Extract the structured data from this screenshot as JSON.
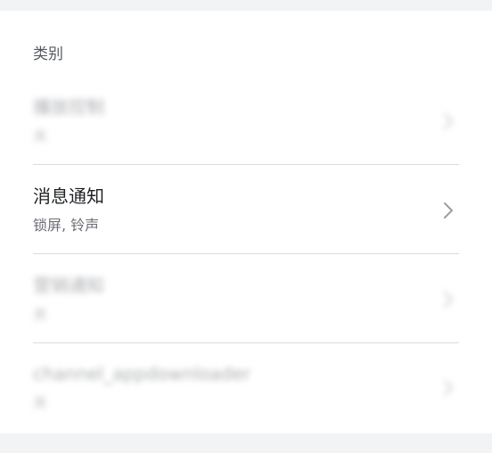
{
  "section": {
    "title": "类别"
  },
  "rows": [
    {
      "title": "播放控制",
      "subtitle": "关",
      "blurred": true
    },
    {
      "title": "消息通知",
      "subtitle": "锁屏, 铃声",
      "blurred": false
    },
    {
      "title": "营销通知",
      "subtitle": "关",
      "blurred": true
    },
    {
      "title": "channel_appdownloader",
      "subtitle": "关",
      "blurred": true
    }
  ],
  "icons": {
    "row_action": "chevron-right-icon"
  },
  "colors": {
    "background": "#f2f3f5",
    "card": "#ffffff",
    "divider": "#d9dbde",
    "primary_text": "#1f2124",
    "secondary_text": "#6b6f75",
    "chevron": "#9a9da2"
  }
}
